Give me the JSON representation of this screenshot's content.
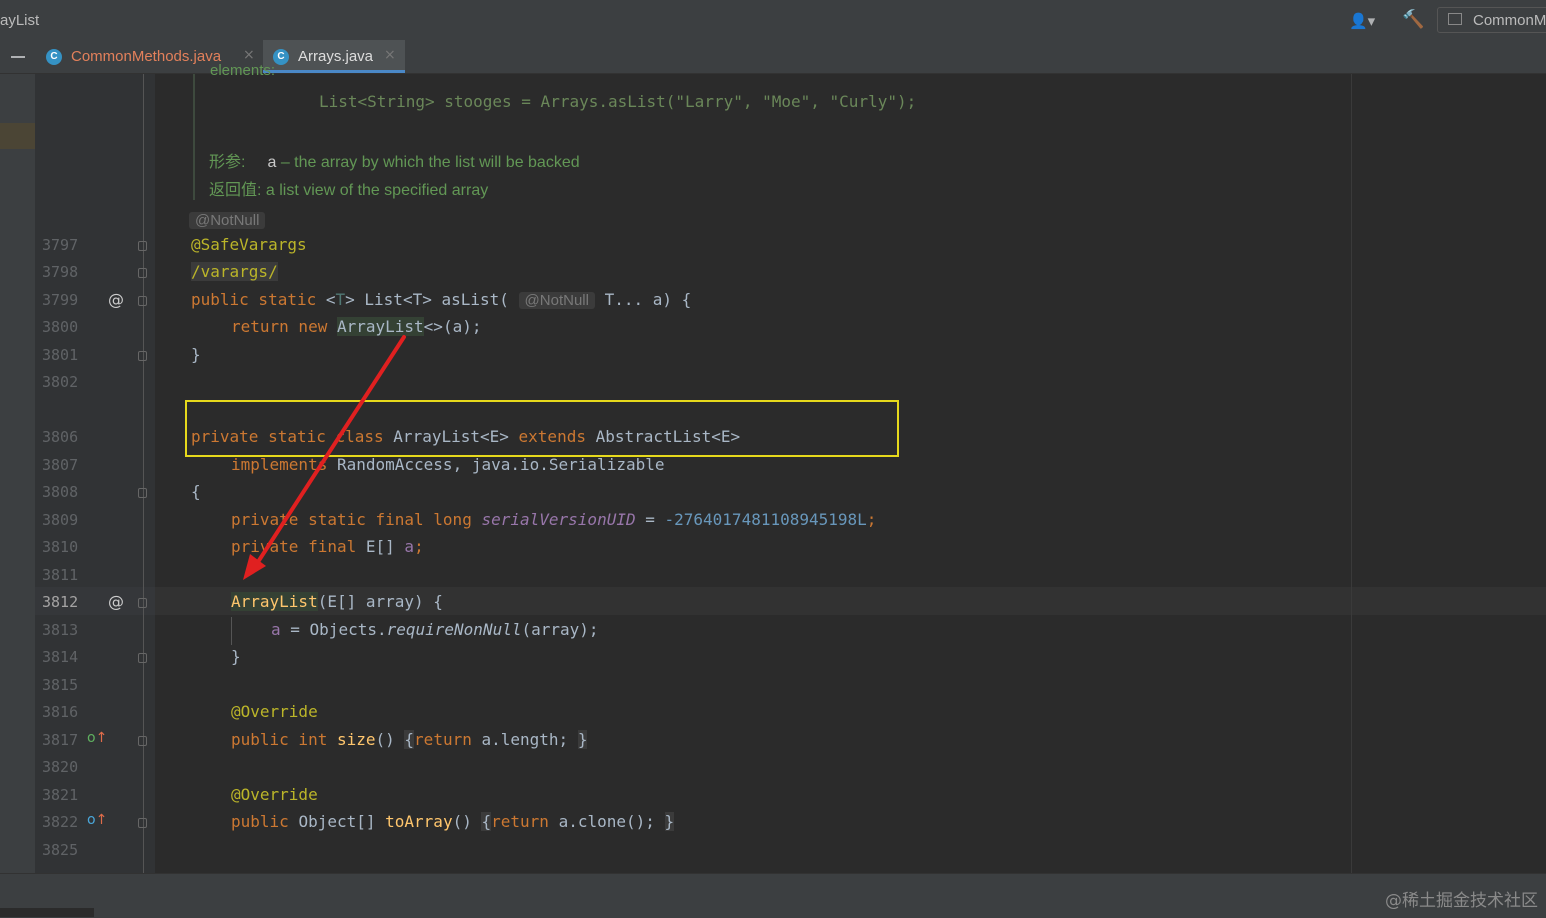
{
  "window": {
    "title": "ayList"
  },
  "toolbar": {
    "run_config": "CommonM",
    "user_icon": "user-dropdown-icon",
    "build_icon": "hammer-icon"
  },
  "tabs": [
    {
      "label": "CommonMethods.java",
      "icon": "java-class-icon",
      "active": false
    },
    {
      "label": "Arrays.java",
      "icon": "java-class-icon",
      "active": true
    }
  ],
  "javadoc": {
    "cut_text": "elements:",
    "example": "List<String> stooges = Arrays.asList(\"Larry\", \"Moe\", \"Curly\");",
    "param_label": "形参:",
    "param_name": "a",
    "param_desc": "– the array by which the list will be backed",
    "return_label": "返回值:",
    "return_desc": "a list view of the specified array"
  },
  "inlay_hints": {
    "notnull": "@NotNull"
  },
  "line_numbers": [
    "3797",
    "3798",
    "3799",
    "3800",
    "3801",
    "3802",
    "3806",
    "3807",
    "3808",
    "3809",
    "3810",
    "3811",
    "3812",
    "3813",
    "3814",
    "3815",
    "3816",
    "3817",
    "3820",
    "3821",
    "3822",
    "3825"
  ],
  "current_line": "3812",
  "code": {
    "l3797": "@SafeVarargs",
    "l3798": "/varargs/",
    "l3799_kw": "public static",
    "l3799_sig": "List<T> asList(",
    "l3799_end": "T... a) {",
    "l3800_kw": "return new",
    "l3800_cls": "ArrayList",
    "l3800_end": "<>(a);",
    "l3801": "}",
    "l3806_kw": "private static class",
    "l3806_name": "ArrayList<E>",
    "l3806_ext": "extends",
    "l3806_sup": "AbstractList<E>",
    "l3807_kw": "implements",
    "l3807_rest": "RandomAccess, java.io.Serializable",
    "l3808": "{",
    "l3809_kw": "private static final long",
    "l3809_field": "serialVersionUID",
    "l3809_eq": " = ",
    "l3809_num": "-2764017481108945198L",
    "l3810_kw": "private final",
    "l3810_type": "E[]",
    "l3810_field": "a",
    "l3812_fn": "ArrayList",
    "l3812_rest": "(E[] array) {",
    "l3813_field": "a",
    "l3813_rest": " = Objects.",
    "l3813_call": "requireNonNull",
    "l3813_end": "(array);",
    "l3814": "}",
    "l3816": "@Override",
    "l3817_kw": "public int",
    "l3817_fn": "size",
    "l3817_paren": "()",
    "l3817_ret": "return",
    "l3817_body": "a.length;",
    "l3821": "@Override",
    "l3822_kw": "public",
    "l3822_type": "Object[]",
    "l3822_fn": "toArray",
    "l3822_paren": "()",
    "l3822_ret": "return",
    "l3822_body": "a.clone();",
    "brace_open": "{",
    "brace_close": "}"
  },
  "gutter_icons": {
    "override_marker": "@",
    "implements_icon": "override-up-arrow-icon"
  },
  "annotation_overlay": {
    "box_color": "#e6d91c",
    "arrow_color": "#e02020"
  },
  "watermark": "@稀土掘金技术社区"
}
